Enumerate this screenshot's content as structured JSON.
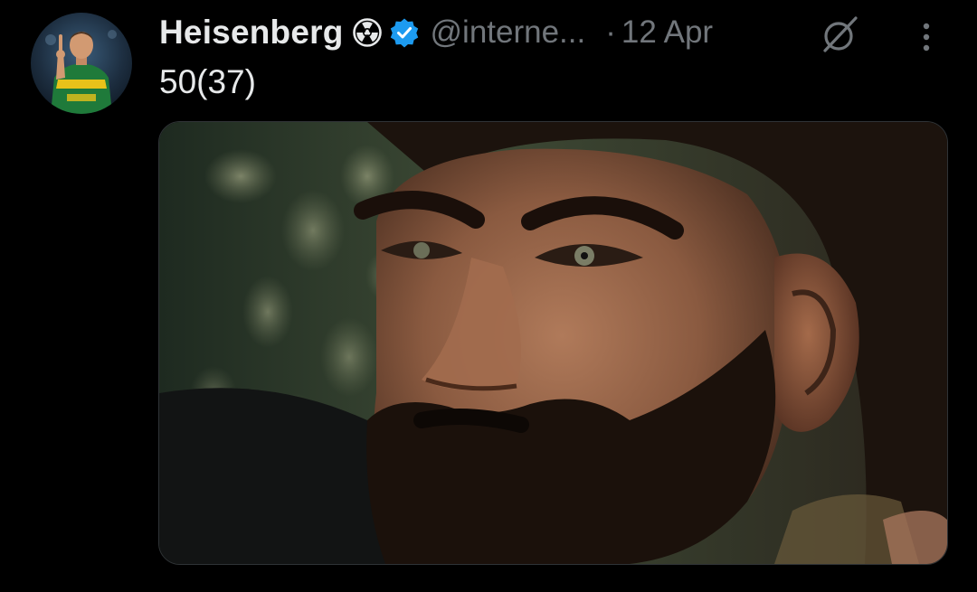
{
  "tweet": {
    "author": {
      "display_name": "Heisenberg",
      "handle": "@interne...",
      "verified": true,
      "name_emoji": "radiation-icon",
      "avatar": "cricketer-avatar"
    },
    "separator": "·",
    "timestamp": "12 Apr",
    "text": "50(37)",
    "media": {
      "type": "image",
      "description_icon": "bearded-man-closeup-photo"
    },
    "actions": {
      "grok_icon": "slashed-circle-icon",
      "more_icon": "more-vertical-icon"
    }
  },
  "colors": {
    "background": "#000000",
    "primary_text": "#e7e9ea",
    "secondary_text": "#71767b",
    "verified_blue": "#1d9bf0",
    "border": "#2f3336"
  }
}
